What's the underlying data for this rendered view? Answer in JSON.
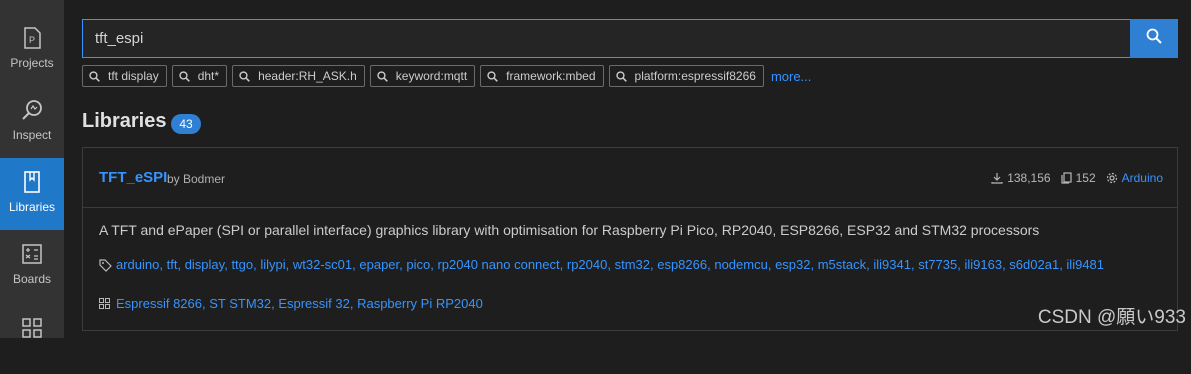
{
  "sidebar": {
    "items": [
      {
        "label": "Projects",
        "icon": "projects-icon"
      },
      {
        "label": "Inspect",
        "icon": "inspect-icon"
      },
      {
        "label": "Libraries",
        "icon": "libraries-icon",
        "active": true
      },
      {
        "label": "Boards",
        "icon": "boards-icon"
      },
      {
        "label": "",
        "icon": "devices-icon"
      }
    ]
  },
  "search": {
    "value": "tft_espi",
    "button_icon": "search-icon"
  },
  "chips": [
    "tft display",
    "dht*",
    "header:RH_ASK.h",
    "keyword:mqtt",
    "framework:mbed",
    "platform:espressif8266"
  ],
  "more_label": "more...",
  "libraries": {
    "title": "Libraries",
    "count": "43"
  },
  "card": {
    "name": "TFT_eSPI",
    "by": "by Bodmer",
    "downloads": "138,156",
    "examples": "152",
    "platform": "Arduino",
    "description": "A TFT and ePaper (SPI or parallel interface) graphics library with optimisation for Raspberry Pi Pico, RP2040, ESP8266, ESP32 and STM32 processors",
    "tags": [
      "arduino",
      "tft",
      "display",
      "ttgo",
      "lilypi",
      "wt32-sc01",
      "epaper",
      "pico",
      "rp2040 nano connect",
      "rp2040",
      "stm32",
      "esp8266",
      "nodemcu",
      "esp32",
      "m5stack",
      "ili9341",
      "st7735",
      "ili9163",
      "s6d02a1",
      "ili9481"
    ],
    "categories": "Espressif 8266, ST STM32, Espressif 32, Raspberry Pi RP2040"
  },
  "watermark": "CSDN @願い933",
  "colors": {
    "accent": "#2f7fd3",
    "link": "#3794ff",
    "background": "#1e1e1e",
    "sidebar": "#333333"
  }
}
